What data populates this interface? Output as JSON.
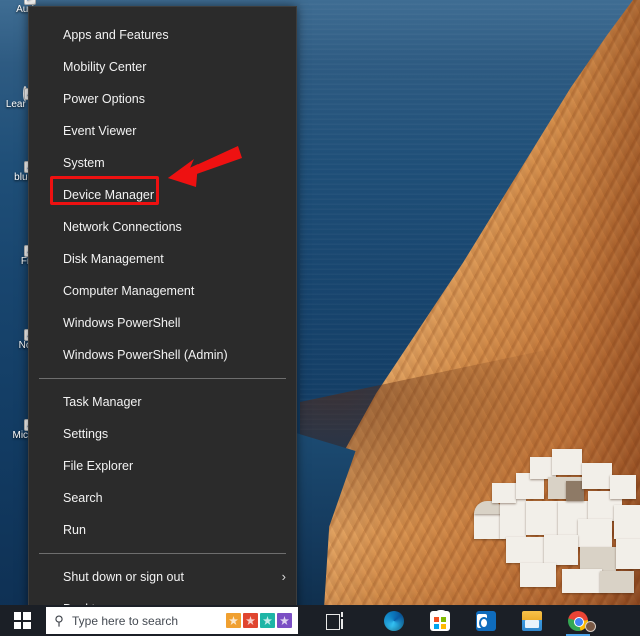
{
  "desktop": {
    "wallpaper_description": "Greek island cliff with sea and white village at sunset",
    "icons": [
      {
        "name": "audacity-shortcut",
        "label": "Aud",
        "color": "#2f6fd0"
      },
      {
        "name": "learn-this-shortcut",
        "label": "Lear\nthis",
        "color": "#2a2a2a"
      },
      {
        "name": "bluetooth-file-shortcut",
        "label": "bluet",
        "color": "#f3dfa2"
      },
      {
        "name": "firefox-shortcut",
        "label": "Fi",
        "color": "#e8640c"
      },
      {
        "name": "notion-shortcut",
        "label": "No",
        "color": "#3f6fe0"
      },
      {
        "name": "microsoft-edge-beta-shortcut",
        "label": "Mic\nB",
        "color": "#2aa8e0"
      }
    ]
  },
  "power_menu": {
    "title": "Win+X Power User Menu",
    "background_color": "#2b2b2b",
    "text_color": "#f2f2f2",
    "groups": [
      {
        "items": [
          {
            "label": "Apps and Features",
            "name": "apps-and-features"
          },
          {
            "label": "Mobility Center",
            "name": "mobility-center"
          },
          {
            "label": "Power Options",
            "name": "power-options"
          },
          {
            "label": "Event Viewer",
            "name": "event-viewer"
          },
          {
            "label": "System",
            "name": "system"
          },
          {
            "label": "Device Manager",
            "name": "device-manager",
            "highlighted": true
          },
          {
            "label": "Network Connections",
            "name": "network-connections"
          },
          {
            "label": "Disk Management",
            "name": "disk-management"
          },
          {
            "label": "Computer Management",
            "name": "computer-management"
          },
          {
            "label": "Windows PowerShell",
            "name": "windows-powershell"
          },
          {
            "label": "Windows PowerShell (Admin)",
            "name": "windows-powershell-admin"
          }
        ]
      },
      {
        "items": [
          {
            "label": "Task Manager",
            "name": "task-manager"
          },
          {
            "label": "Settings",
            "name": "settings"
          },
          {
            "label": "File Explorer",
            "name": "file-explorer"
          },
          {
            "label": "Search",
            "name": "search"
          },
          {
            "label": "Run",
            "name": "run"
          }
        ]
      },
      {
        "items": [
          {
            "label": "Shut down or sign out",
            "name": "shut-down-or-sign-out",
            "submenu": true,
            "chevron": "›"
          },
          {
            "label": "Desktop",
            "name": "desktop"
          }
        ]
      }
    ]
  },
  "annotations": {
    "highlight_color": "#ee1111",
    "highlight_target": "Device Manager",
    "arrow_color": "#ee1111",
    "arrow_points_to": "Device Manager"
  },
  "taskbar": {
    "background_color": "#1b1f26",
    "start_button": {
      "name": "start-button",
      "label": "Start"
    },
    "search": {
      "placeholder": "Type here to search",
      "icon": "search-icon",
      "decoration": "papel-picado-banner",
      "flag_colors": [
        "#f0a030",
        "#e0452f",
        "#1eb5a6",
        "#7b4fc4"
      ]
    },
    "icons": [
      {
        "name": "task-view-icon",
        "label": "Task View",
        "class": "ic-taskview"
      },
      {
        "name": "microsoft-edge-icon",
        "label": "Microsoft Edge",
        "class": "ic-edge"
      },
      {
        "name": "microsoft-store-icon",
        "label": "Microsoft Store",
        "class": "ic-store"
      },
      {
        "name": "outlook-icon",
        "label": "Outlook",
        "class": "ic-outlook"
      },
      {
        "name": "file-explorer-icon",
        "label": "File Explorer",
        "class": "ic-explorer"
      },
      {
        "name": "google-chrome-icon",
        "label": "Google Chrome",
        "class": "ic-chrome",
        "avatar": true,
        "running": true
      }
    ]
  }
}
